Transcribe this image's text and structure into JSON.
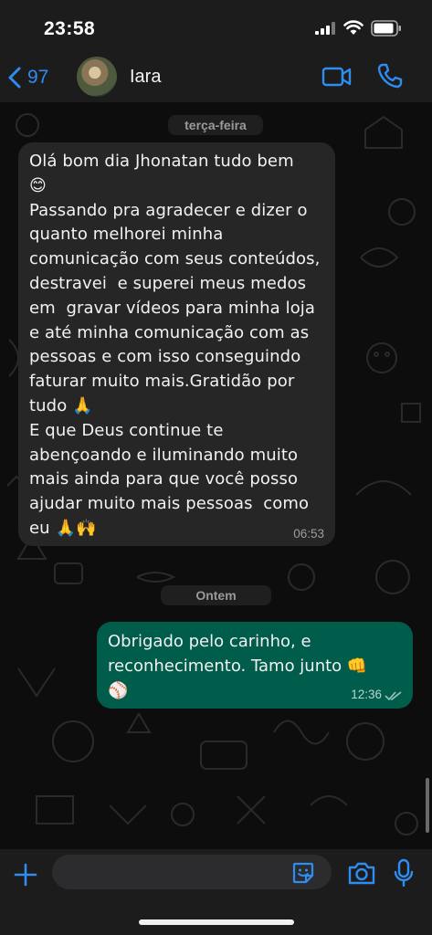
{
  "status_bar": {
    "time": "23:58"
  },
  "header": {
    "back_count": "97",
    "contact_name": "Iara"
  },
  "chat": {
    "date_1": "terça-feira",
    "date_2": "Ontem",
    "incoming": {
      "text": "Olá bom dia Jhonatan tudo bem\n😊\nPassando pra agradecer e dizer o quanto melhorei minha comunicação com seus conteúdos, destravei  e superei meus medos em  gravar vídeos para minha loja e até minha comunicação com as pessoas e com isso conseguindo faturar muito mais.Gratidão por tudo 🙏\nE que Deus continue te abençoando e iluminando muito mais ainda para que você posso ajudar muito mais pessoas  como eu 🙏🙌",
      "time": "06:53"
    },
    "outgoing": {
      "text": "Obrigado pelo carinho, e reconhecimento. Tamo junto 👊\n⚾",
      "time": "12:36"
    }
  },
  "composer": {
    "placeholder": ""
  },
  "colors": {
    "accent": "#2f8cf0",
    "outgoing_bubble": "#005c4b",
    "incoming_bubble": "#262626"
  },
  "icons": [
    "chevron-left-icon",
    "video-camera-icon",
    "phone-icon",
    "plus-icon",
    "sticker-icon",
    "camera-icon",
    "microphone-icon",
    "double-check-icon"
  ]
}
